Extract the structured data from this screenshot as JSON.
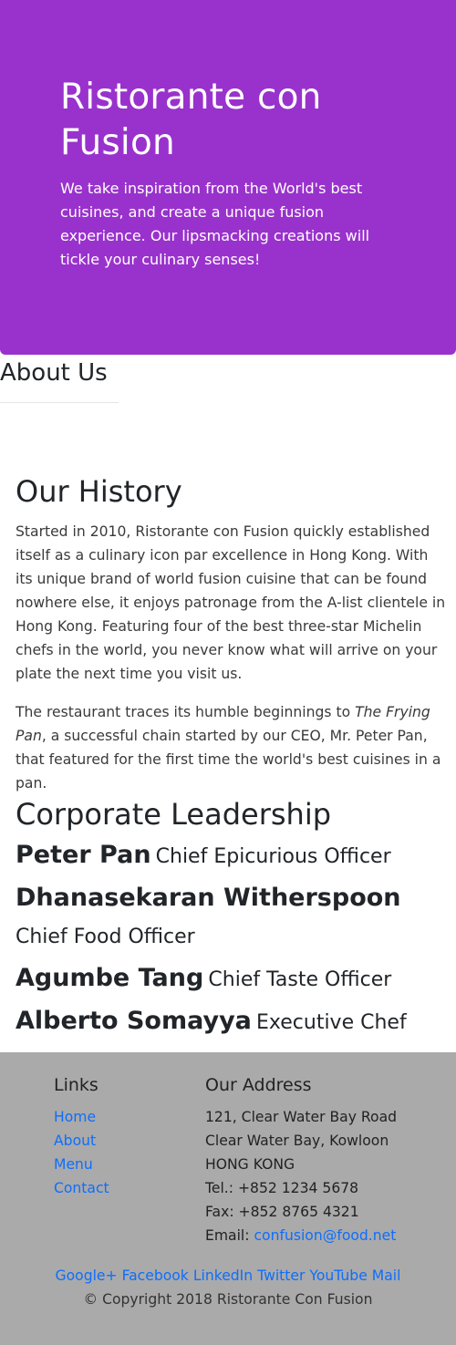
{
  "jumbotron": {
    "title": "Ristorante con Fusion",
    "description": "We take inspiration from the World's best cuisines, and create a unique fusion experience. Our lipsmacking creations will tickle your culinary senses!"
  },
  "about": {
    "heading": "About Us"
  },
  "history": {
    "heading": "Our History",
    "paragraph1": "Started in 2010, Ristorante con Fusion quickly established itself as a culinary icon par excellence in Hong Kong. With its unique brand of world fusion cuisine that can be found nowhere else, it enjoys patronage from the A-list clientele in Hong Kong. Featuring four of the best three-star Michelin chefs in the world, you never know what will arrive on your plate the next time you visit us.",
    "paragraph2_before": "The restaurant traces its humble beginnings to ",
    "paragraph2_italic": "The Frying Pan",
    "paragraph2_after": ", a successful chain started by our CEO, Mr. Peter Pan, that featured for the first time the world's best cuisines in a pan."
  },
  "leadership": {
    "heading": "Corporate Leadership",
    "leaders": [
      {
        "name": "Peter Pan",
        "role": "Chief Epicurious Officer"
      },
      {
        "name": "Dhanasekaran Witherspoon",
        "role": "Chief Food Officer"
      },
      {
        "name": "Agumbe Tang",
        "role": "Chief Taste Officer"
      },
      {
        "name": "Alberto Somayya",
        "role": "Executive Chef"
      }
    ]
  },
  "footer": {
    "links_heading": "Links",
    "links": [
      "Home",
      "About",
      "Menu",
      "Contact"
    ],
    "address_heading": "Our Address",
    "address_lines": [
      "121, Clear Water Bay Road",
      "Clear Water Bay, Kowloon",
      "HONG KONG",
      "Tel.: +852 1234 5678",
      "Fax: +852 8765 4321"
    ],
    "email_label": "Email: ",
    "email": "confusion@food.net",
    "social": [
      "Google+",
      "Facebook",
      "LinkedIn",
      "Twitter",
      "YouTube",
      "Mail"
    ],
    "copyright": "© Copyright 2018 Ristorante Con Fusion"
  },
  "colors": {
    "jumbotron_bg": "#9932cc",
    "footer_bg": "#aaaaaa",
    "link": "#0d6efd"
  }
}
